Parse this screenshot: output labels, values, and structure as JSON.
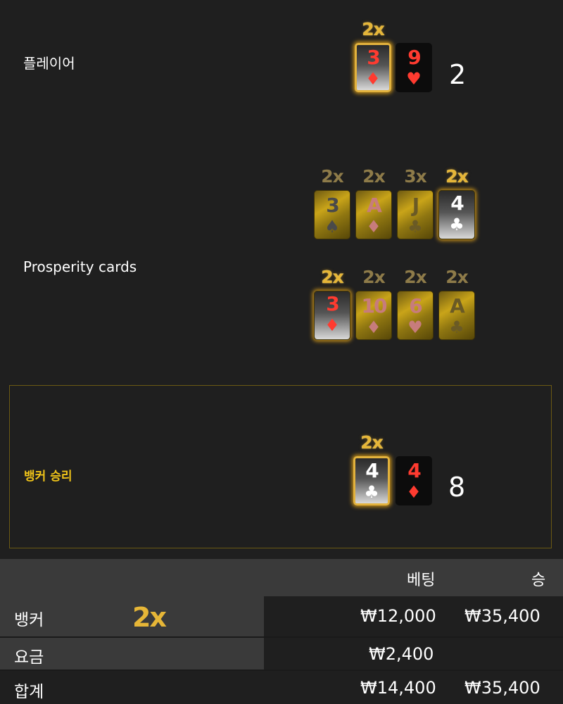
{
  "player": {
    "label": "플레이어",
    "score": "2",
    "cards": [
      {
        "rank": "3",
        "suit": "♦",
        "multiplier": "2x"
      },
      {
        "rank": "9",
        "suit": "♥",
        "multiplier": ""
      }
    ]
  },
  "prosperity": {
    "label": "Prosperity cards",
    "row1": [
      {
        "rank": "3",
        "suit": "♠",
        "multiplier": "2x"
      },
      {
        "rank": "A",
        "suit": "♦",
        "multiplier": "2x"
      },
      {
        "rank": "J",
        "suit": "♣",
        "multiplier": "3x"
      },
      {
        "rank": "4",
        "suit": "♣",
        "multiplier": "2x"
      }
    ],
    "row2": [
      {
        "rank": "3",
        "suit": "♦",
        "multiplier": "2x"
      },
      {
        "rank": "10",
        "suit": "♦",
        "multiplier": "2x"
      },
      {
        "rank": "6",
        "suit": "♥",
        "multiplier": "2x"
      },
      {
        "rank": "A",
        "suit": "♣",
        "multiplier": "2x"
      }
    ]
  },
  "banker": {
    "label": "뱅커 승리",
    "score": "8",
    "cards": [
      {
        "rank": "4",
        "suit": "♣",
        "multiplier": "2x"
      },
      {
        "rank": "4",
        "suit": "♦",
        "multiplier": ""
      }
    ]
  },
  "table": {
    "header_bet": "베팅",
    "header_win": "승",
    "rows": [
      {
        "name": "뱅커",
        "multiplier": "2x",
        "bet": "₩12,000",
        "win": "₩35,400"
      },
      {
        "name": "요금",
        "multiplier": "",
        "bet": "₩2,400",
        "win": ""
      },
      {
        "name": "합계",
        "multiplier": "",
        "bet": "₩14,400",
        "win": "₩35,400"
      }
    ]
  }
}
